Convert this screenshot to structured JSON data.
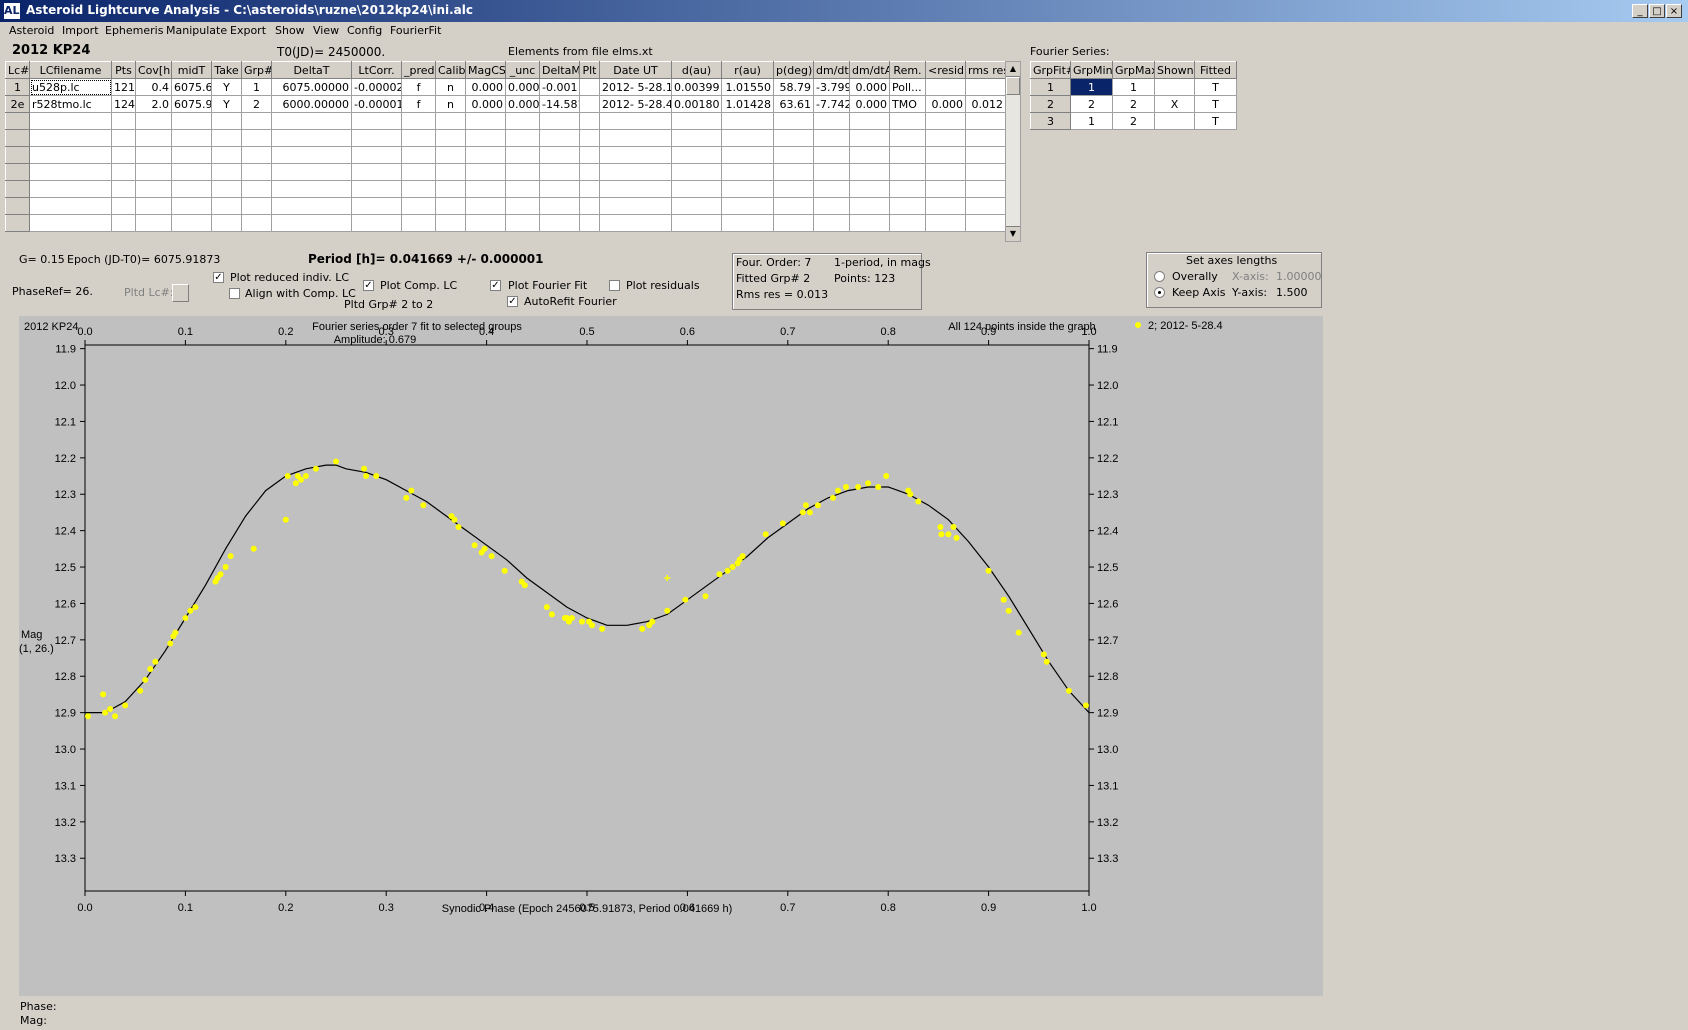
{
  "window": {
    "title": "Asteroid Lightcurve Analysis - C:\\asteroids\\ruzne\\2012kp24\\ini.alc",
    "icon": "ALC",
    "min_label": "_",
    "max_label": "□",
    "close_label": "×"
  },
  "menu": [
    "Asteroid",
    "Import",
    "Ephemeris",
    "Manipulate",
    "Export",
    "Show",
    "View",
    "Config",
    "FourierFit"
  ],
  "header": {
    "asteroid": "2012 KP24",
    "t0": "T0(JD)= 2450000.",
    "elements": "Elements from file elms.xt"
  },
  "lc_table": {
    "columns": [
      "Lc#",
      "LCfilename",
      "Pts",
      "Cov[h]",
      "midT",
      "Take",
      "Grp#",
      "DeltaT",
      "LtCorr.",
      "_pred.",
      "Calib.",
      "MagCS",
      "_unc",
      "DeltaM",
      "Plt",
      "Date UT",
      "d(au)",
      "r(au)",
      "p(deg)",
      "dm/dt",
      "dm/dtA",
      "Rem.",
      "<resid>",
      "rms res"
    ],
    "rows": [
      [
        "1",
        "u528p.lc",
        "121",
        "0.4",
        "6075.6",
        "Y",
        "1",
        "6075.00000",
        "-0.00002",
        "f",
        "n",
        "0.000",
        "0.000",
        "-0.001",
        "",
        "2012- 5-28.1",
        "0.00399",
        "1.01550",
        "58.79",
        "-3.799",
        "0.000",
        "Poll...",
        "",
        ""
      ],
      [
        "2e",
        "r528tmo.lc",
        "124",
        "2.0",
        "6075.9",
        "Y",
        "2",
        "6000.00000",
        "-0.00001",
        "f",
        "n",
        "0.000",
        "0.000",
        "-14.581",
        "",
        "2012- 5-28.4",
        "0.00180",
        "1.01428",
        "63.61",
        "-7.742",
        "0.000",
        "TMO",
        "0.000",
        "0.012"
      ]
    ],
    "empty_rows": 7
  },
  "fourier_table": {
    "caption": "Fourier Series:",
    "columns": [
      "GrpFit#",
      "GrpMin",
      "GrpMax",
      "Shown",
      "Fitted"
    ],
    "rows": [
      [
        "1",
        "1",
        "1",
        "",
        "T"
      ],
      [
        "2",
        "2",
        "2",
        "X",
        "T"
      ],
      [
        "3",
        "1",
        "2",
        "",
        "T"
      ]
    ]
  },
  "controls": {
    "g": "G= 0.15",
    "epoch": "Epoch (JD-T0)= 6075.91873",
    "period": "Period [h]= 0.041669 +/- 0.000001",
    "phaseref": "PhaseRef= 26.",
    "pltd_lc": "Pltd Lc#:",
    "plot_reduced": "Plot reduced indiv. LC",
    "plot_reduced_checked": true,
    "align_comp": "Align with Comp. LC",
    "align_comp_checked": false,
    "plot_comp": "Plot Comp. LC",
    "plot_comp_checked": true,
    "pltd_grp": "Pltd Grp#  2  to   2",
    "plot_fourier": "Plot Fourier Fit",
    "plot_fourier_checked": true,
    "autorefit": "AutoRefit Fourier",
    "autorefit_checked": true,
    "plot_residuals": "Plot residuals",
    "plot_residuals_checked": false
  },
  "fit_info": {
    "order": "Four. Order:  7",
    "period_mode": "1-period, in mags",
    "fitted_grp": "Fitted Grp# 2",
    "points": "Points: 123",
    "rms": "Rms res     = 0.013"
  },
  "axes_box": {
    "title": "Set axes lengths",
    "overally": "Overally",
    "keep_axis": "Keep Axis",
    "x_axis_label": "X-axis:",
    "x_axis_value": "1.00000",
    "y_axis_label": "Y-axis:",
    "y_axis_value": "1.500",
    "selected": "keep_axis"
  },
  "status": {
    "phase": "Phase:",
    "mag": "Mag:"
  },
  "colors": {
    "plot_bg": "#c0c0c0",
    "points": "#ffff00",
    "fit_line": "#000000",
    "selected_cell": "#0a246a"
  },
  "chart_data": {
    "type": "scatter",
    "title": "Fourier series order 7 fit to selected groups",
    "subtitle": "Amplitude: 0.679",
    "corner_label": "2012 KP24",
    "note": "All 124 points inside the graph",
    "legend": "2; 2012- 5-28.4",
    "legend_placement": "top-right",
    "xlabel": "Synodic Phase (Epoch 2456075.91873, Period 0.041669 h)",
    "ylabel": "Mag",
    "ylabel2": "(1, 26.)",
    "xlim": [
      0.0,
      1.0
    ],
    "ylim": [
      13.39,
      11.89
    ],
    "y_inverted": true,
    "xticks": [
      "0.0",
      "0.1",
      "0.2",
      "0.3",
      "0.4",
      "0.5",
      "0.6",
      "0.7",
      "0.8",
      "0.9",
      "1.0"
    ],
    "yticks": [
      "11.9",
      "12.0",
      "12.1",
      "12.2",
      "12.3",
      "12.4",
      "12.5",
      "12.6",
      "12.7",
      "12.8",
      "12.9",
      "13.0",
      "13.1",
      "13.2",
      "13.3"
    ],
    "fit_curve": {
      "x": [
        0.0,
        0.02,
        0.04,
        0.06,
        0.08,
        0.1,
        0.12,
        0.14,
        0.16,
        0.18,
        0.2,
        0.22,
        0.24,
        0.25,
        0.26,
        0.28,
        0.3,
        0.32,
        0.34,
        0.36,
        0.38,
        0.4,
        0.42,
        0.44,
        0.46,
        0.48,
        0.5,
        0.52,
        0.54,
        0.56,
        0.58,
        0.6,
        0.62,
        0.64,
        0.66,
        0.68,
        0.7,
        0.72,
        0.74,
        0.76,
        0.78,
        0.79,
        0.8,
        0.82,
        0.84,
        0.86,
        0.88,
        0.9,
        0.92,
        0.94,
        0.96,
        0.98,
        1.0
      ],
      "y": [
        12.9,
        12.9,
        12.87,
        12.81,
        12.73,
        12.64,
        12.55,
        12.45,
        12.36,
        12.29,
        12.25,
        12.23,
        12.22,
        12.22,
        12.23,
        12.24,
        12.26,
        12.29,
        12.32,
        12.36,
        12.4,
        12.44,
        12.48,
        12.53,
        12.57,
        12.61,
        12.64,
        12.66,
        12.66,
        12.65,
        12.63,
        12.59,
        12.55,
        12.51,
        12.47,
        12.42,
        12.38,
        12.34,
        12.31,
        12.29,
        12.28,
        12.28,
        12.28,
        12.3,
        12.33,
        12.37,
        12.43,
        12.5,
        12.58,
        12.67,
        12.76,
        12.84,
        12.9
      ]
    },
    "series": [
      {
        "name": "2; 2012- 5-28.4",
        "x": [
          0.003,
          0.018,
          0.02,
          0.025,
          0.03,
          0.04,
          0.055,
          0.06,
          0.065,
          0.07,
          0.085,
          0.088,
          0.09,
          0.1,
          0.105,
          0.11,
          0.13,
          0.132,
          0.135,
          0.14,
          0.145,
          0.168,
          0.2,
          0.202,
          0.21,
          0.212,
          0.215,
          0.22,
          0.23,
          0.25,
          0.278,
          0.28,
          0.29,
          0.32,
          0.325,
          0.337,
          0.365,
          0.368,
          0.372,
          0.388,
          0.395,
          0.398,
          0.405,
          0.418,
          0.435,
          0.438,
          0.46,
          0.465,
          0.478,
          0.48,
          0.482,
          0.485,
          0.495,
          0.502,
          0.505,
          0.515,
          0.555,
          0.562,
          0.565,
          0.58,
          0.598,
          0.618,
          0.632,
          0.64,
          0.645,
          0.65,
          0.652,
          0.655,
          0.678,
          0.695,
          0.715,
          0.718,
          0.722,
          0.73,
          0.745,
          0.75,
          0.758,
          0.77,
          0.78,
          0.79,
          0.798,
          0.82,
          0.822,
          0.83,
          0.852,
          0.853,
          0.86,
          0.865,
          0.868,
          0.9,
          0.915,
          0.92,
          0.93,
          0.955,
          0.958,
          0.98,
          0.997
        ],
        "y": [
          12.91,
          12.85,
          12.9,
          12.89,
          12.91,
          12.88,
          12.84,
          12.81,
          12.78,
          12.76,
          12.71,
          12.69,
          12.68,
          12.64,
          12.62,
          12.61,
          12.54,
          12.53,
          12.52,
          12.5,
          12.47,
          12.45,
          12.37,
          12.25,
          12.27,
          12.25,
          12.26,
          12.25,
          12.23,
          12.21,
          12.23,
          12.25,
          12.25,
          12.31,
          12.29,
          12.33,
          12.36,
          12.37,
          12.39,
          12.44,
          12.46,
          12.45,
          12.47,
          12.51,
          12.54,
          12.55,
          12.61,
          12.63,
          12.64,
          12.64,
          12.65,
          12.64,
          12.65,
          12.65,
          12.66,
          12.67,
          12.67,
          12.66,
          12.65,
          12.62,
          12.59,
          12.58,
          12.52,
          12.51,
          12.5,
          12.49,
          12.48,
          12.47,
          12.41,
          12.38,
          12.35,
          12.33,
          12.35,
          12.33,
          12.31,
          12.29,
          12.28,
          12.28,
          12.27,
          12.28,
          12.25,
          12.29,
          12.3,
          12.32,
          12.39,
          12.41,
          12.41,
          12.39,
          12.42,
          12.51,
          12.59,
          12.62,
          12.68,
          12.74,
          12.76,
          12.84,
          12.88
        ]
      }
    ],
    "outlier": {
      "x": 0.58,
      "y": 12.53
    }
  }
}
